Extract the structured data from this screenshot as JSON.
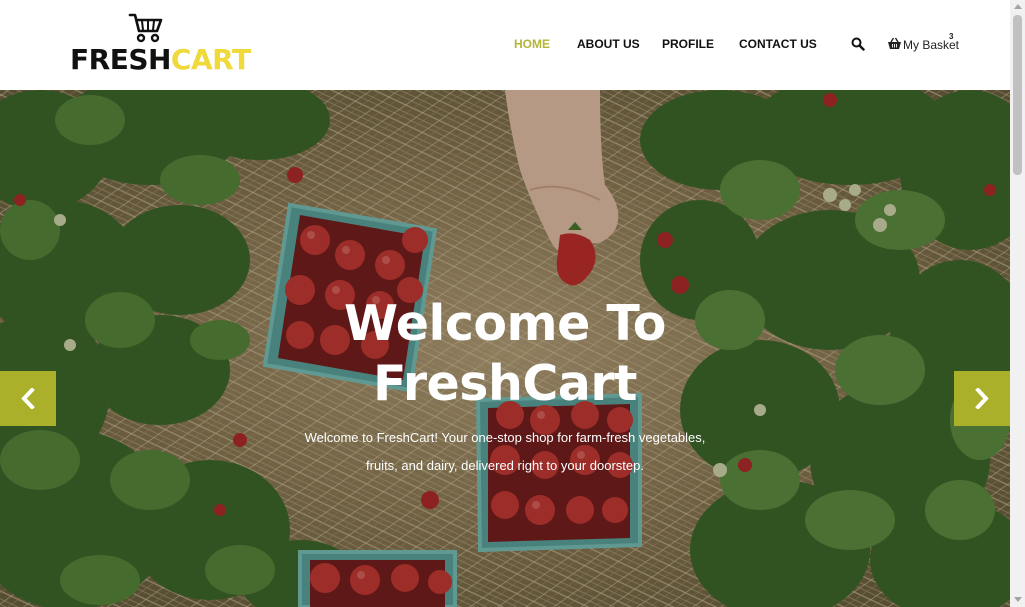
{
  "brand": {
    "name_part1": "FRESH",
    "name_part2": "CART",
    "accent_color": "#f0d93a",
    "icon": "shopping-cart-icon"
  },
  "nav": {
    "items": [
      {
        "label": "HOME",
        "active": true
      },
      {
        "label": "ABOUT US",
        "active": false
      },
      {
        "label": "PROFILE",
        "active": false
      },
      {
        "label": "CONTACT US",
        "active": false
      }
    ],
    "active_color": "#b3b537",
    "search_icon": "search-icon",
    "basket": {
      "label": "My Basket",
      "count": "3",
      "icon": "basket-icon"
    }
  },
  "hero": {
    "title_line1": "Welcome To",
    "title_line2": "FreshCart",
    "subtitle_line1": "Welcome to FreshCart! Your one-stop shop for farm-fresh vegetables,",
    "subtitle_line2": "fruits, and dairy, delivered right to your doorstep.",
    "prev_icon": "chevron-left-icon",
    "next_icon": "chevron-right-icon",
    "arrow_color": "#aab02a",
    "background_image": "strawberry-field-photo"
  }
}
